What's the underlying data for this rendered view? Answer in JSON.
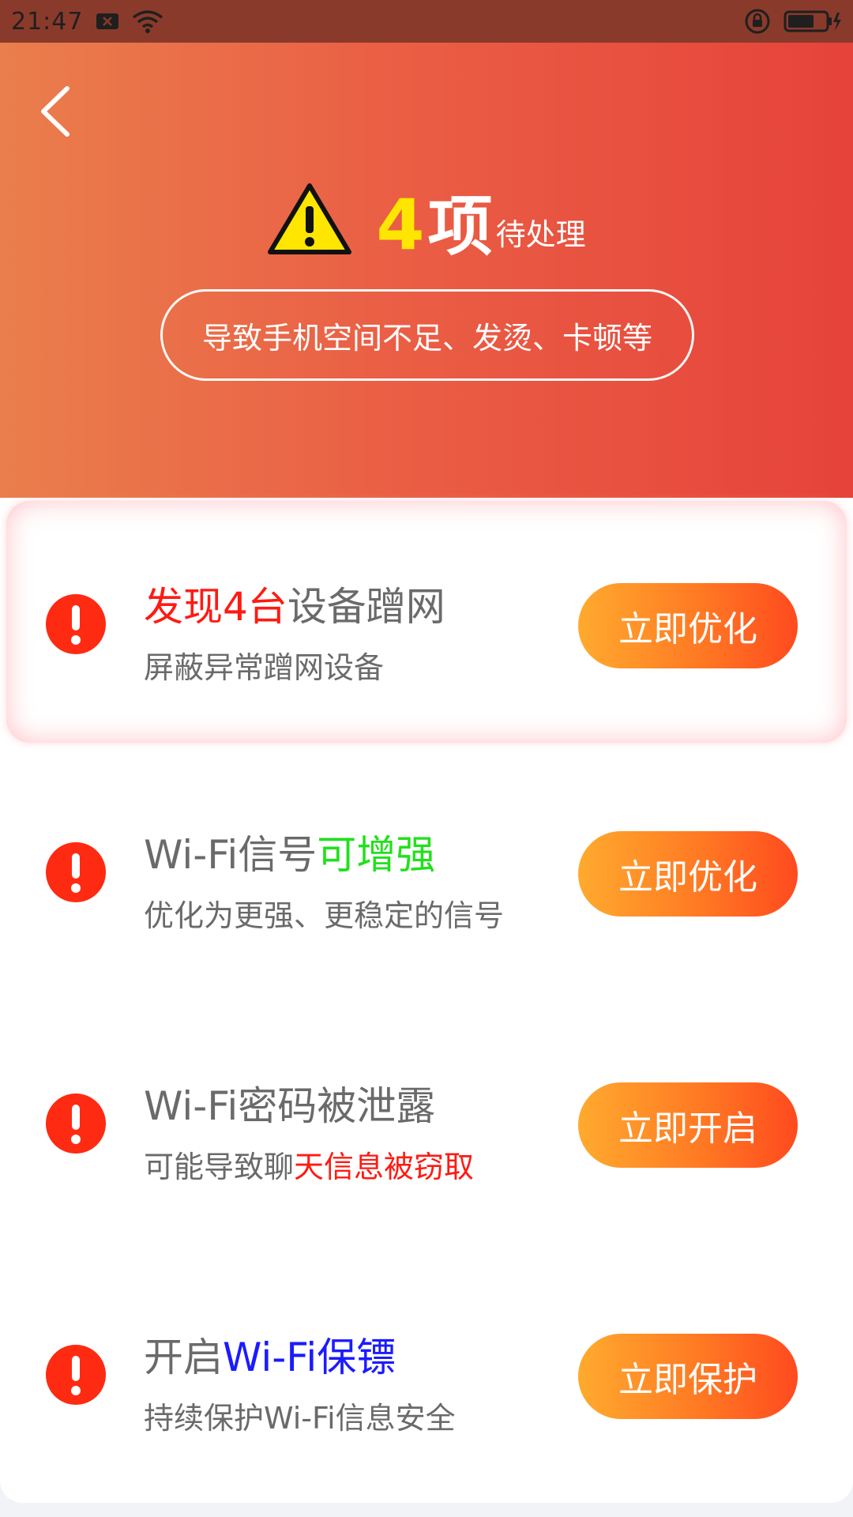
{
  "status_bar": {
    "time": "21:47"
  },
  "header": {
    "count_number": "4",
    "count_unit": "项",
    "count_suffix": "待处理",
    "reason": "导致手机空间不足、发烫、卡顿等"
  },
  "items": [
    {
      "title_prefix": "",
      "title_highlight": "发现4台",
      "title_suffix": "设备蹭网",
      "subtitle_plain": "屏蔽异常蹭网设备",
      "subtitle_highlight": "",
      "button": "立即优化"
    },
    {
      "title_prefix": "Wi-Fi信号",
      "title_highlight": "可增强",
      "title_suffix": "",
      "subtitle_plain": "优化为更强、更稳定的信号",
      "subtitle_highlight": "",
      "button": "立即优化"
    },
    {
      "title_prefix": "Wi-Fi密码被泄露",
      "title_highlight": "",
      "title_suffix": "",
      "subtitle_plain": "可能导致聊",
      "subtitle_highlight": "天信息被窃取",
      "button": "立即开启"
    },
    {
      "title_prefix": "开启",
      "title_highlight": "Wi-Fi保镖",
      "title_suffix": "",
      "subtitle_plain": "持续保护Wi-Fi信息安全",
      "subtitle_highlight": "",
      "button": "立即保护"
    }
  ],
  "colors": {
    "header_start": "#ea7e4c",
    "header_end": "#e6433a",
    "count_yellow": "#ffe600",
    "alert_red": "#ff2a12",
    "highlight_red": "#ff1a12",
    "highlight_green": "#22e01d",
    "highlight_blue": "#1b1bff",
    "button_start": "#ffaa2e",
    "button_end": "#ff4a1f"
  }
}
